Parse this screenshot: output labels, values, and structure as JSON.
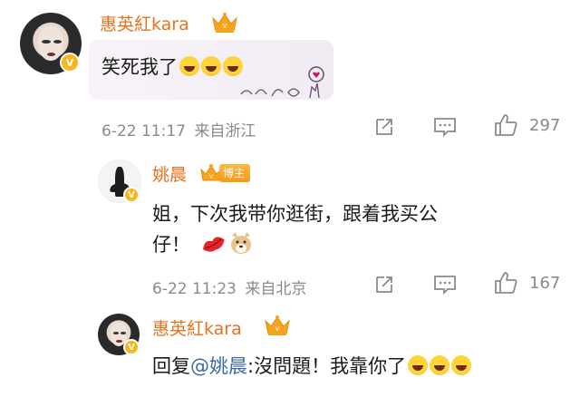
{
  "comments": [
    {
      "username": "惠英紅kara",
      "text": "笑死我了",
      "date": "6-22 11:17",
      "location": "来自浙江",
      "likes": "297"
    },
    {
      "username": "姚晨",
      "badge": "博主",
      "text_line1": "姐，下次我带你逛街，跟着我买公",
      "text_line2": "仔！",
      "date": "6-22 11:23",
      "location": "来自北京",
      "likes": "167"
    },
    {
      "username": "惠英紅kara",
      "reply_prefix": "回复",
      "mention": "@姚晨",
      "text": ":沒問題！我靠你了"
    }
  ],
  "colors": {
    "username": "#e8711c",
    "mention": "#3b6aa8",
    "meta": "#8a8a8a",
    "badge": "#f39a1a"
  }
}
